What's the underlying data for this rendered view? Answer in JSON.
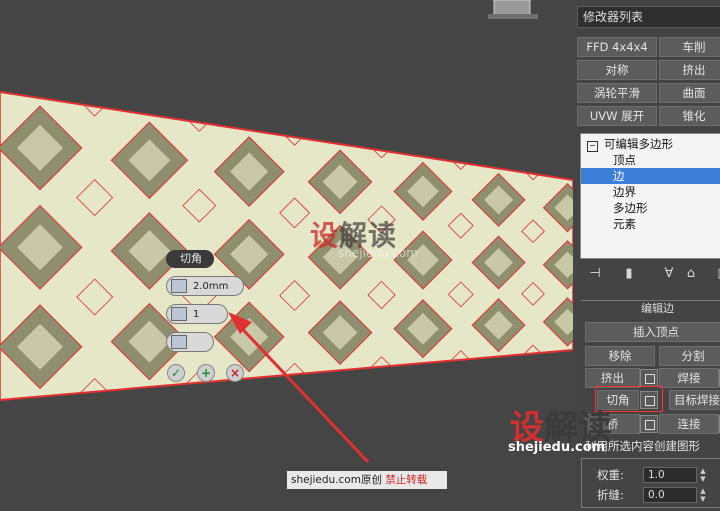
{
  "caddy": {
    "title": "切角",
    "amount": "2.0mm",
    "segments": "1"
  },
  "watermarks": {
    "center_brand_first": "设",
    "center_brand_rest": "解读",
    "center_url": "shejiedu.com",
    "right_brand_first": "设",
    "right_brand_rest": "解读",
    "right_url": "shejiedu.com"
  },
  "credit": {
    "site": "shejiedu.com",
    "original": "原创",
    "forbid": "禁止转载"
  },
  "panel": {
    "modifier_list": "修改器列表",
    "modifier_buttons": [
      "FFD 4x4x4",
      "车削",
      "对称",
      "挤出",
      "涡轮平滑",
      "曲面",
      "UVW 展开",
      "锥化"
    ],
    "stack": {
      "root": "可编辑多边形",
      "items": [
        "顶点",
        "边",
        "边界",
        "多边形",
        "元素"
      ],
      "selected": "边"
    },
    "rollout_title": "编辑边",
    "buttons": {
      "insert_vertex": "插入顶点",
      "remove": "移除",
      "split": "分割",
      "extrude": "挤出",
      "weld": "焊接",
      "chamfer": "切角",
      "target_weld": "目标焊接",
      "bridge": "桥",
      "connect": "连接",
      "create_shape": "利用所选内容创建图形"
    },
    "weight_label": "权重:",
    "weight_value": "1.0",
    "crease_label": "折缝:",
    "crease_value": "0.0"
  },
  "colors": {
    "highlight": "#ff3030",
    "selection": "#3b7fd9",
    "brand_red": "#d03030"
  }
}
